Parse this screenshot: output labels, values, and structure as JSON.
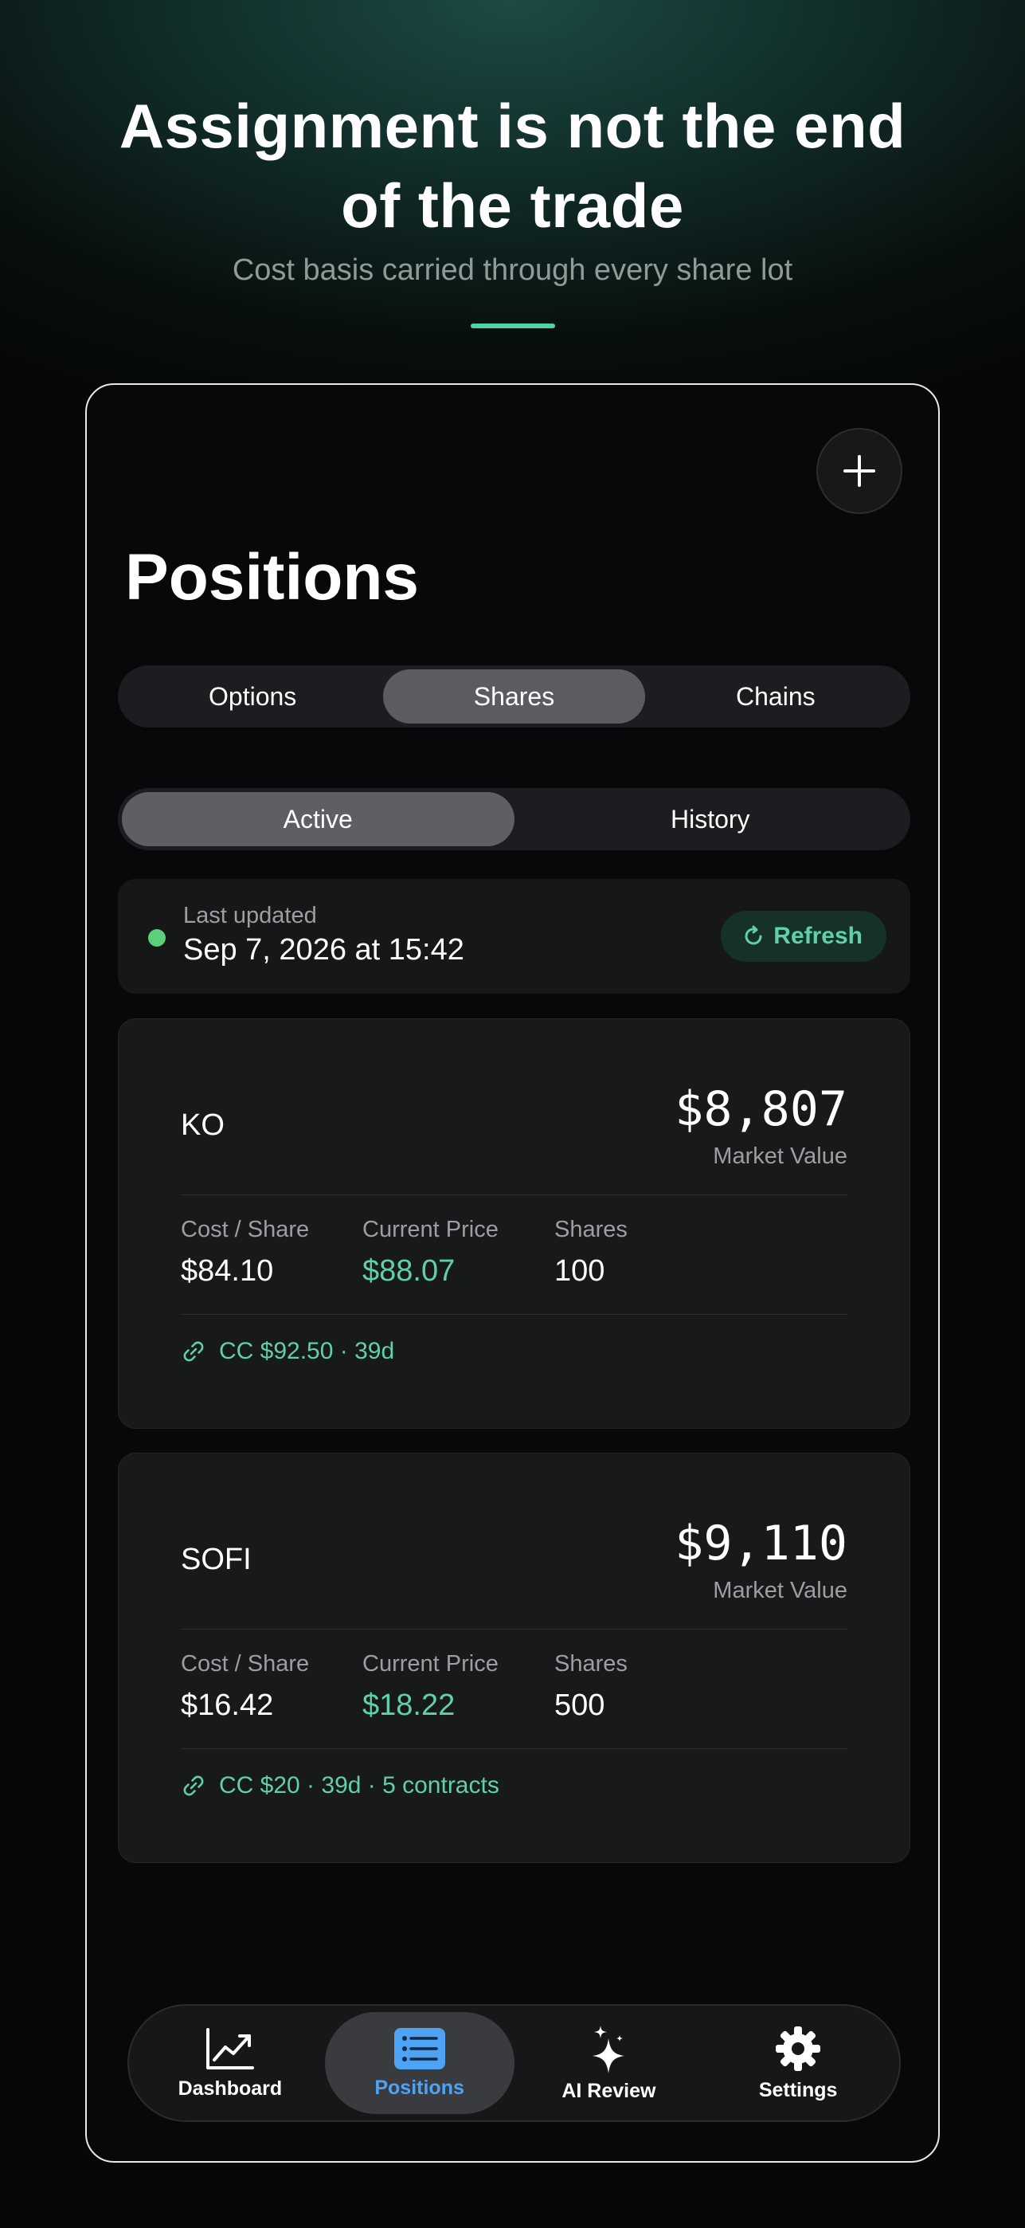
{
  "promo": {
    "headline_line1": "Assignment is not the end",
    "headline_line2": "of the trade",
    "subtitle": "Cost basis carried through every share lot",
    "accent_color": "#4fd3a5"
  },
  "screen": {
    "title": "Positions",
    "add_icon": "plus-icon",
    "asset_tabs": [
      {
        "label": "Options",
        "active": false
      },
      {
        "label": "Shares",
        "active": true
      },
      {
        "label": "Chains",
        "active": false
      }
    ],
    "status_tabs": [
      {
        "label": "Active",
        "active": true
      },
      {
        "label": "History",
        "active": false
      }
    ],
    "updated": {
      "label": "Last updated",
      "value": "Sep 7, 2026 at 15:42",
      "refresh_label": "Refresh",
      "status_color": "#5ccf7a"
    },
    "positions": [
      {
        "ticker": "KO",
        "market_value": "$8,807",
        "market_value_label": "Market Value",
        "cost_label": "Cost / Share",
        "cost": "$84.10",
        "price_label": "Current Price",
        "price": "$88.07",
        "shares_label": "Shares",
        "shares": "100",
        "covered_call": "CC $92.50 · 39d"
      },
      {
        "ticker": "SOFI",
        "market_value": "$9,110",
        "market_value_label": "Market Value",
        "cost_label": "Cost / Share",
        "cost": "$16.42",
        "price_label": "Current Price",
        "price": "$18.22",
        "shares_label": "Shares",
        "shares": "500",
        "covered_call": "CC $20 · 39d · 5 contracts"
      }
    ],
    "tab_bar": [
      {
        "label": "Dashboard",
        "icon": "chart-icon",
        "active": false
      },
      {
        "label": "Positions",
        "icon": "list-icon",
        "active": true
      },
      {
        "label": "AI Review",
        "icon": "sparkle-icon",
        "active": false
      },
      {
        "label": "Settings",
        "icon": "gear-icon",
        "active": false
      }
    ],
    "colors": {
      "positive": "#5fd0a8",
      "active_tab": "#4ea3f5"
    }
  }
}
